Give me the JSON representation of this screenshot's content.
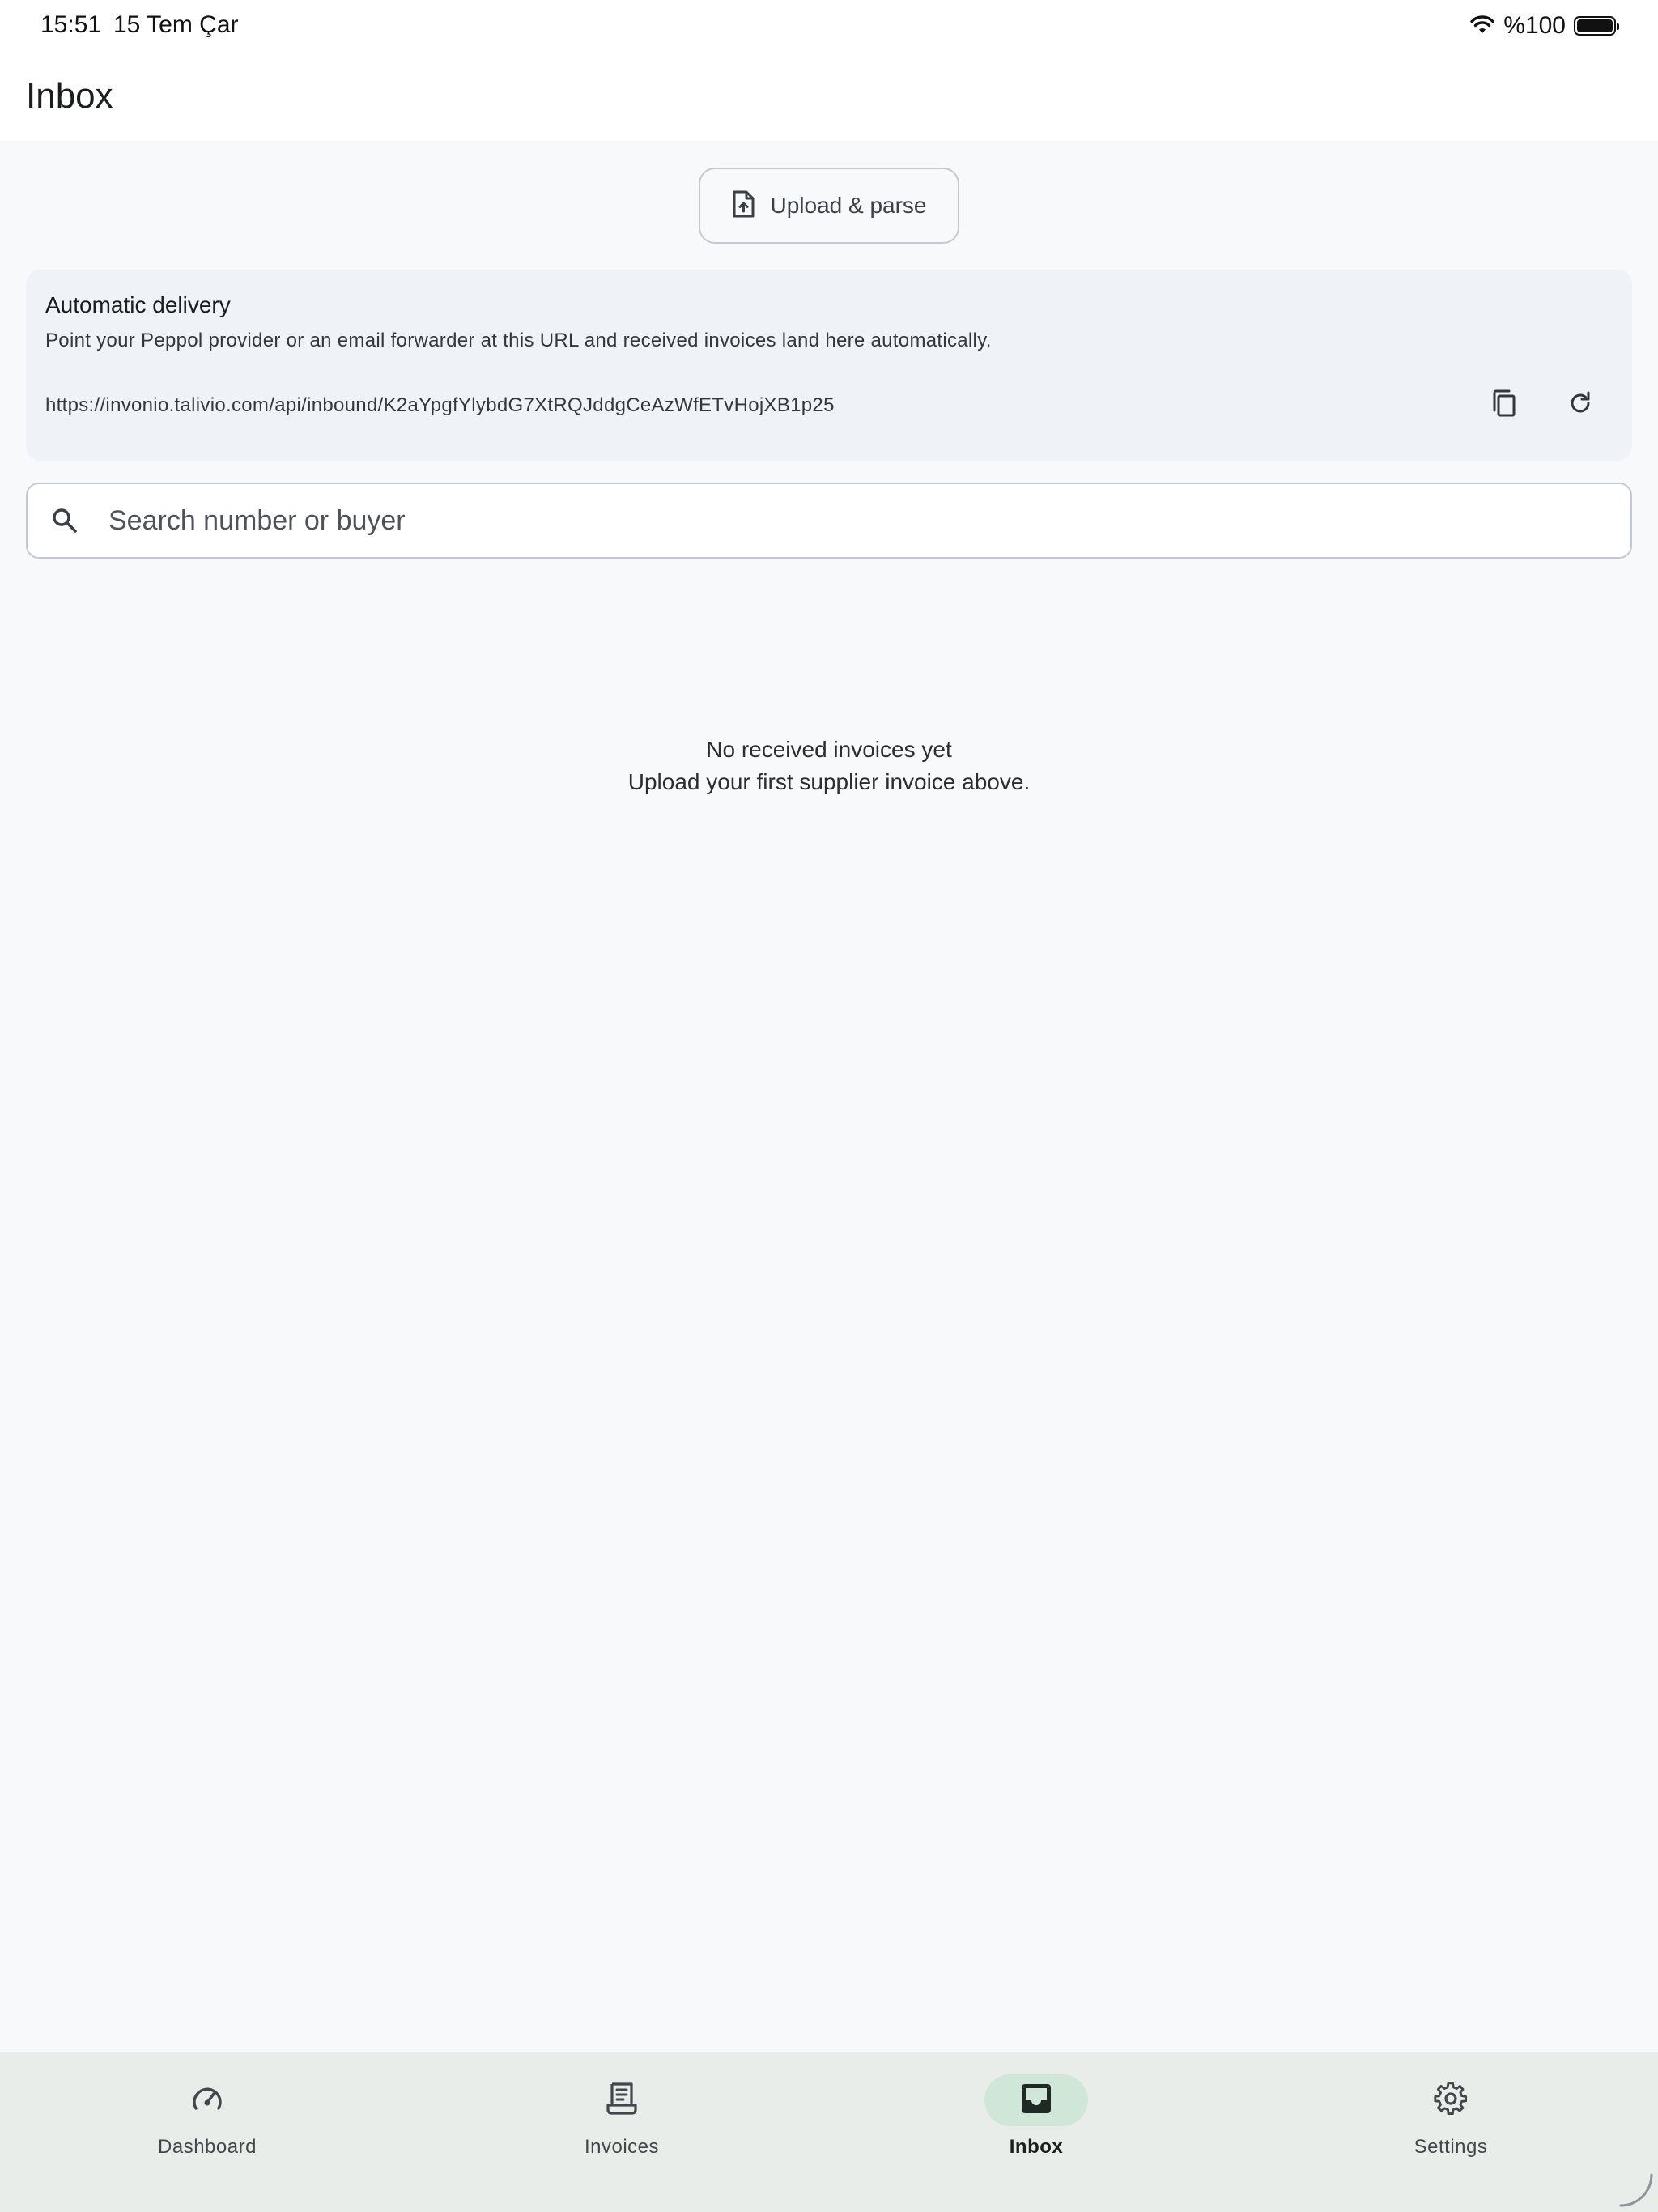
{
  "status_bar": {
    "time": "15:51",
    "date": "15 Tem Çar",
    "battery": "%100"
  },
  "app_bar": {
    "title": "Inbox"
  },
  "upload": {
    "label": "Upload & parse",
    "icon": "file-upload-icon"
  },
  "delivery": {
    "title": "Automatic delivery",
    "description": "Point your Peppol provider or an email forwarder at this URL and received invoices land here automatically.",
    "url": "https://invonio.talivio.com/api/inbound/K2aYpgfYlybdG7XtRQJddgCeAzWfETvHojXB1p25",
    "copy_icon": "copy-icon",
    "refresh_icon": "refresh-icon"
  },
  "search": {
    "placeholder": "Search number or buyer",
    "value": ""
  },
  "empty_state": {
    "title": "No received invoices yet",
    "subtitle": "Upload your first supplier invoice above."
  },
  "nav": {
    "items": [
      {
        "label": "Dashboard",
        "icon": "speedometer-icon",
        "active": false
      },
      {
        "label": "Invoices",
        "icon": "receipt-icon",
        "active": false
      },
      {
        "label": "Inbox",
        "icon": "inbox-icon",
        "active": true
      },
      {
        "label": "Settings",
        "icon": "gear-icon",
        "active": false
      }
    ]
  },
  "colors": {
    "background": "#f7f9fb",
    "card": "#eff2f6",
    "nav_background": "#e8ede9",
    "nav_active_pill": "#cfe6d8"
  }
}
